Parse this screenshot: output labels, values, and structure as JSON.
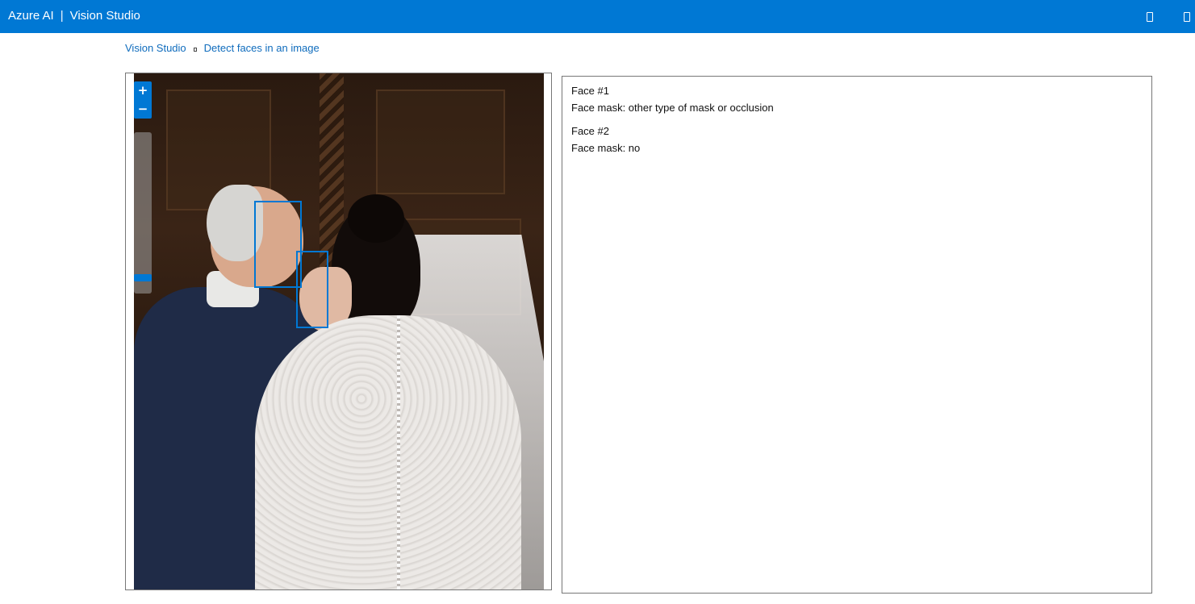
{
  "header": {
    "brand": "Azure AI",
    "separator": "|",
    "product": "Vision Studio",
    "icons": [
      "panel-icon",
      "window-icon"
    ]
  },
  "breadcrumb": {
    "items": [
      "Vision Studio",
      "Detect faces in an image"
    ]
  },
  "image_viewer": {
    "zoom_in_label": "+",
    "zoom_out_label": "−",
    "zoom_level_fraction": 0.92,
    "face_box_color": "#0078d4"
  },
  "results": [
    {
      "title": "Face #1",
      "detail": "Face mask: other type of mask or occlusion"
    },
    {
      "title": "Face #2",
      "detail": "Face mask: no"
    }
  ],
  "colors": {
    "accent": "#0078d4",
    "link": "#0f6cbd"
  }
}
